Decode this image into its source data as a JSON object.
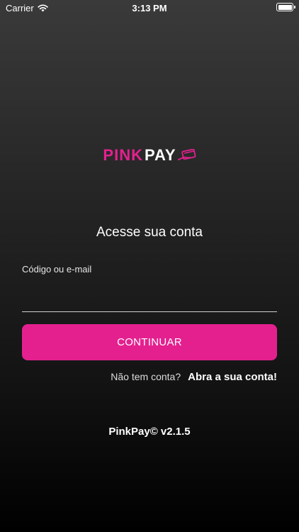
{
  "status_bar": {
    "carrier": "Carrier",
    "time": "3:13 PM",
    "wifi_icon": "wifi-icon",
    "battery_icon": "battery-icon"
  },
  "logo": {
    "part1": "PINK",
    "part2": "PAY",
    "icon": "card-hand-icon",
    "pink_color": "#e4208f"
  },
  "login": {
    "title": "Acesse sua conta",
    "field_label": "Código ou e-mail",
    "field_value": "",
    "continue_label": "CONTINUAR",
    "no_account_text": "Não tem conta?",
    "signup_link": "Abra a sua conta!"
  },
  "footer": {
    "version": "PinkPay© v2.1.5"
  },
  "colors": {
    "accent": "#e4208f",
    "background_top": "#3a3a3a",
    "background_bottom": "#000000"
  }
}
